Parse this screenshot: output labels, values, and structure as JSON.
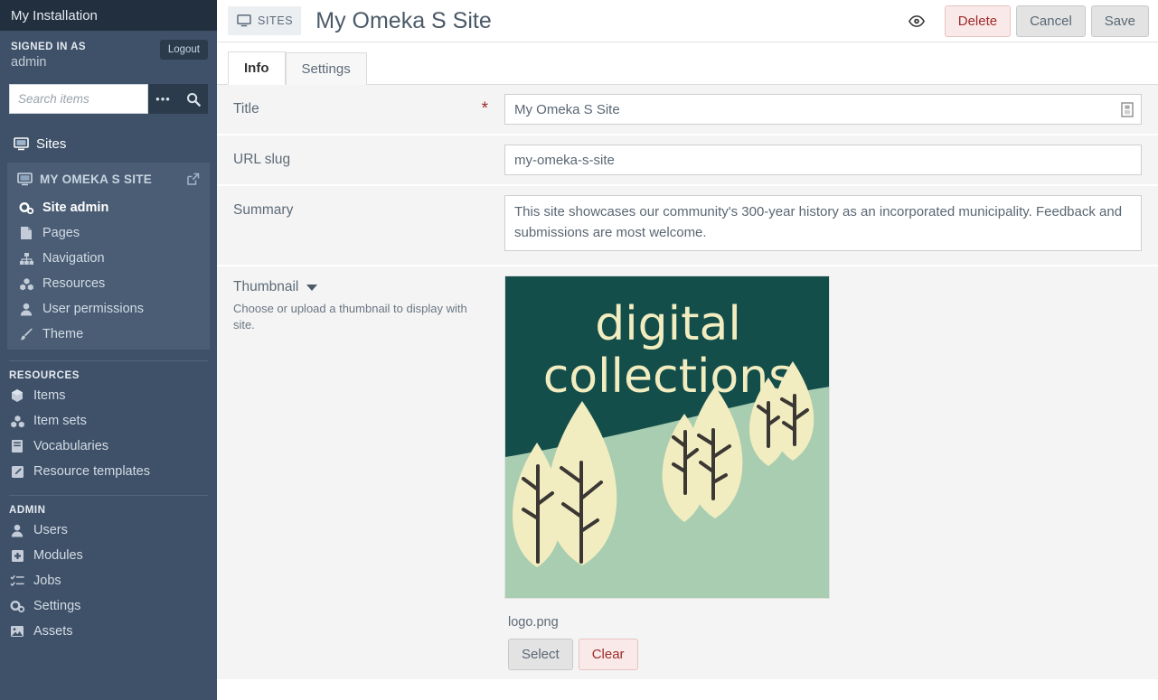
{
  "sidebar": {
    "installation_title": "My Installation",
    "signed_in_label": "SIGNED IN AS",
    "user_name": "admin",
    "logout_label": "Logout",
    "search": {
      "placeholder": "Search items",
      "value": "",
      "advanced_icon": "ellipsis-icon",
      "submit_icon": "search-icon"
    },
    "sites_heading": {
      "label": "Sites",
      "icon": "monitor-icon"
    },
    "active_site": {
      "name": "MY OMEKA S SITE",
      "icon": "monitor-icon",
      "external_link_icon": "external-link-icon",
      "items": [
        {
          "label": "Site admin",
          "icon": "cogs-icon"
        },
        {
          "label": "Pages",
          "icon": "file-icon"
        },
        {
          "label": "Navigation",
          "icon": "sitemap-icon"
        },
        {
          "label": "Resources",
          "icon": "cubes-icon"
        },
        {
          "label": "User permissions",
          "icon": "user-icon"
        },
        {
          "label": "Theme",
          "icon": "brush-icon"
        }
      ]
    },
    "groups": [
      {
        "label": "RESOURCES",
        "items": [
          {
            "label": "Items",
            "icon": "cube-icon"
          },
          {
            "label": "Item sets",
            "icon": "cubes-icon"
          },
          {
            "label": "Vocabularies",
            "icon": "book-icon"
          },
          {
            "label": "Resource templates",
            "icon": "pencil-square-icon"
          }
        ]
      },
      {
        "label": "ADMIN",
        "items": [
          {
            "label": "Users",
            "icon": "user-icon"
          },
          {
            "label": "Modules",
            "icon": "puzzle-plus-icon"
          },
          {
            "label": "Jobs",
            "icon": "tasks-icon"
          },
          {
            "label": "Settings",
            "icon": "cogs-icon"
          },
          {
            "label": "Assets",
            "icon": "image-icon"
          }
        ]
      }
    ]
  },
  "topbar": {
    "breadcrumb_chip": {
      "label": "SITES",
      "icon": "monitor-icon"
    },
    "page_title": "My Omeka S Site",
    "preview_icon": "eye-icon",
    "delete_label": "Delete",
    "cancel_label": "Cancel",
    "save_label": "Save"
  },
  "tabs": [
    {
      "label": "Info",
      "active": true
    },
    {
      "label": "Settings",
      "active": false
    }
  ],
  "form": {
    "title": {
      "label": "Title",
      "required_marker": "*",
      "value": "My Omeka S Site",
      "icon": "language-value-icon"
    },
    "url_slug": {
      "label": "URL slug",
      "value": "my-omeka-s-site"
    },
    "summary": {
      "label": "Summary",
      "value": "This site showcases our community's 300-year history as an incorporated municipality. Feedback and submissions are most welcome."
    },
    "thumbnail": {
      "label": "Thumbnail",
      "caret_icon": "caret-down-icon",
      "description": "Choose or upload a thumbnail to display with site.",
      "filename": "logo.png",
      "select_label": "Select",
      "clear_label": "Clear",
      "image": {
        "alt": "digital collections logo",
        "line1": "digital",
        "line2": "collections",
        "sky_color": "#134e4a",
        "hill_color": "#a9cdb0",
        "tree_color": "#f2edc0",
        "trunk_color": "#3a3734"
      }
    }
  },
  "colors": {
    "sidebar_bg": "#3f5168",
    "sidebar_dark": "#222f3e",
    "sidebar_active": "#4a5d74",
    "field_row_bg": "#f4f4f4",
    "danger": "#9e2a2a",
    "text": "#5d6b78"
  }
}
